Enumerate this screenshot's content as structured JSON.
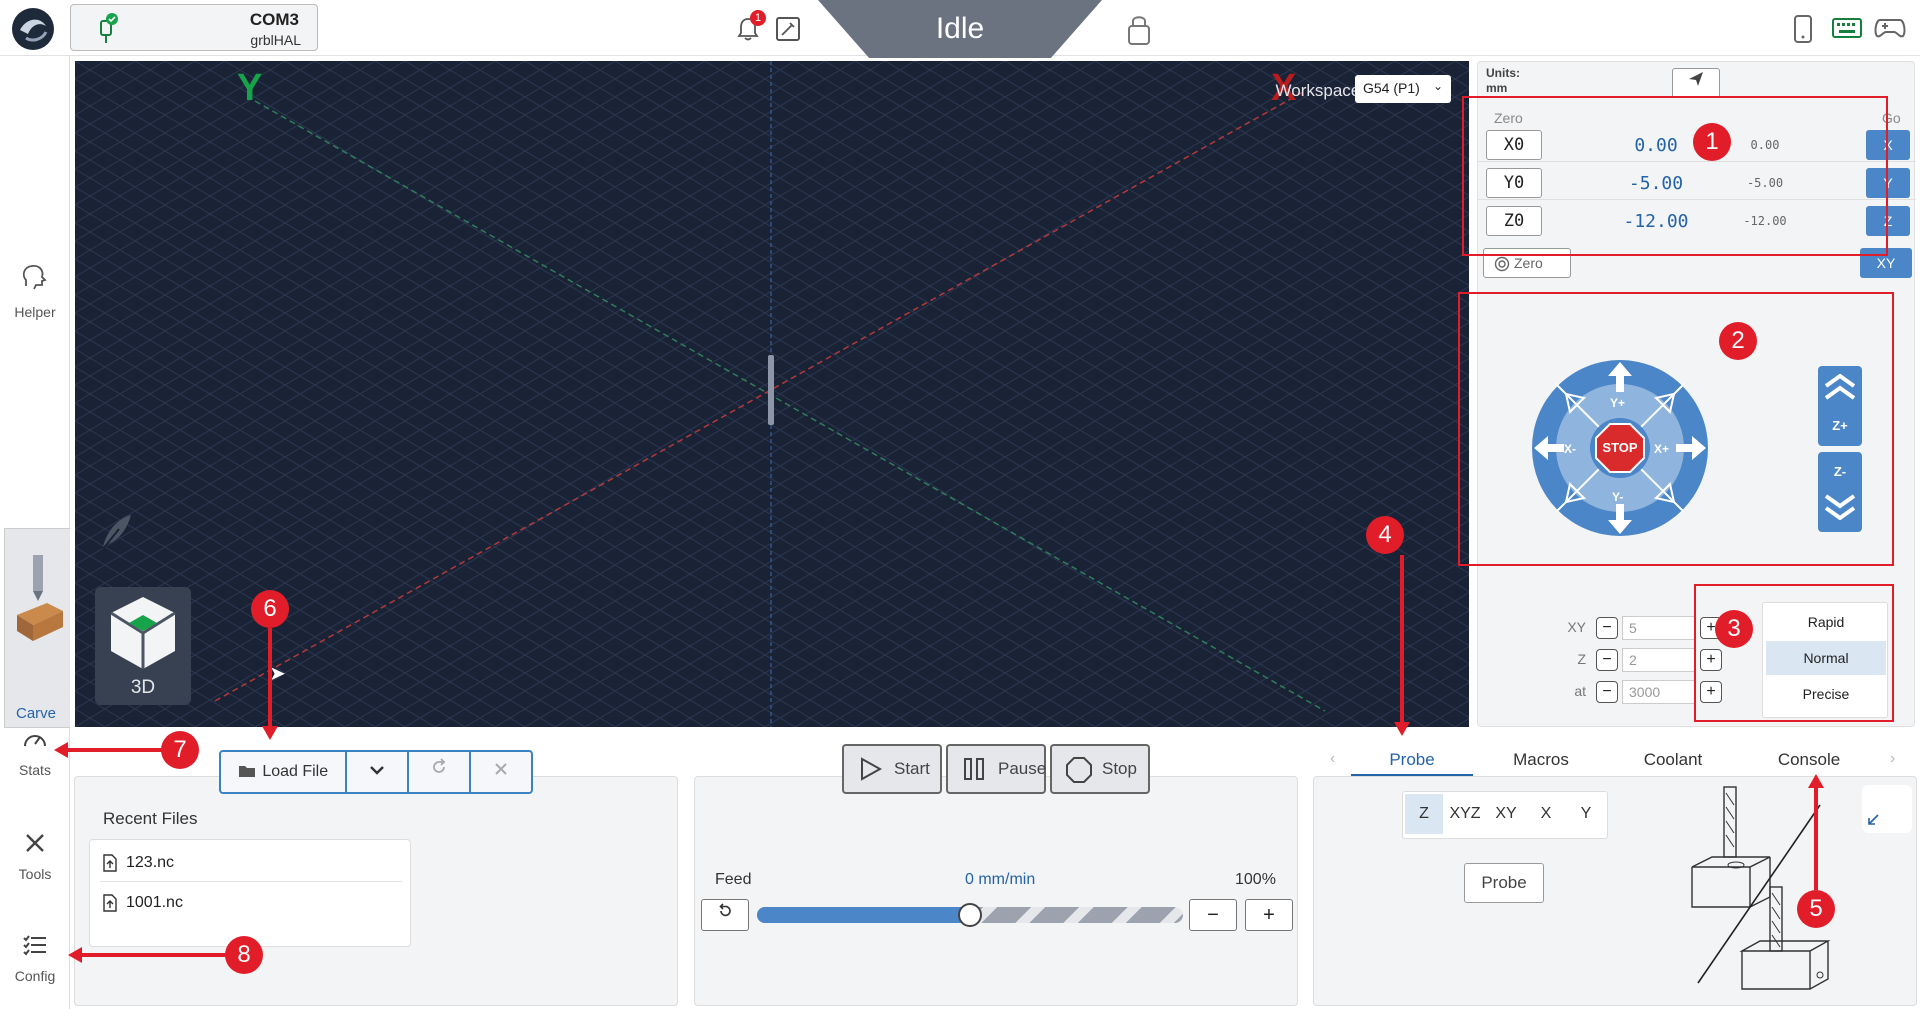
{
  "topbar": {
    "port": "COM3",
    "firmware": "grblHAL",
    "notification_count": "1",
    "machine_state": "Idle"
  },
  "sidebar": {
    "items": [
      {
        "label": "Helper",
        "icon": "helper-icon"
      },
      {
        "label": "Carve",
        "icon": "carve-icon"
      },
      {
        "label": "Stats",
        "icon": "gauge-icon"
      },
      {
        "label": "Tools",
        "icon": "tools-icon"
      },
      {
        "label": "Config",
        "icon": "checklist-icon"
      }
    ]
  },
  "viewport": {
    "axis_x": "X",
    "axis_y": "Y",
    "workspace_label": "Workspace:",
    "workspace_value": "G54 (P1)",
    "view_mode": "3D"
  },
  "dro": {
    "units_label": "Units:",
    "units_value": "mm",
    "zero_header": "Zero",
    "go_header": "Go",
    "axes": [
      {
        "zero_label": "X0",
        "work": "0.00",
        "machine": "0.00",
        "go": "X"
      },
      {
        "zero_label": "Y0",
        "work": "-5.00",
        "machine": "-5.00",
        "go": "Y"
      },
      {
        "zero_label": "Z0",
        "work": "-12.00",
        "machine": "-12.00",
        "go": "Z"
      }
    ],
    "zero_all": "Zero",
    "go_xy": "XY"
  },
  "jog": {
    "stop": "STOP",
    "y_plus": "Y+",
    "y_minus": "Y-",
    "x_plus": "X+",
    "x_minus": "X-",
    "z_plus": "Z+",
    "z_minus": "Z-"
  },
  "jog_settings": {
    "xy_label": "XY",
    "xy_value": "5",
    "z_label": "Z",
    "z_value": "2",
    "at_label": "at",
    "at_value": "3000",
    "speeds": [
      "Rapid",
      "Normal",
      "Precise"
    ],
    "selected_speed": "Normal"
  },
  "file": {
    "load_label": "Load File",
    "recent_title": "Recent Files",
    "recent": [
      "123.nc",
      "1001.nc"
    ]
  },
  "run": {
    "start": "Start",
    "pause": "Pause",
    "stop": "Stop",
    "feed_label": "Feed",
    "feed_value": "0 mm/min",
    "feed_percent": "100%",
    "feed_override_fraction": 0.5
  },
  "tools": {
    "tabs": [
      "Probe",
      "Macros",
      "Coolant",
      "Console"
    ],
    "active_tab": "Probe",
    "probe_modes": [
      "Z",
      "XYZ",
      "XY",
      "X",
      "Y"
    ],
    "selected_probe_mode": "Z",
    "probe_button": "Probe"
  },
  "annotations": [
    "1",
    "2",
    "3",
    "4",
    "5",
    "6",
    "7",
    "8"
  ],
  "colors": {
    "accent": "#4a86c8",
    "annotation": "#e11d2a",
    "viewport_bg": "#1a2235",
    "state_bg": "#6b7280"
  }
}
